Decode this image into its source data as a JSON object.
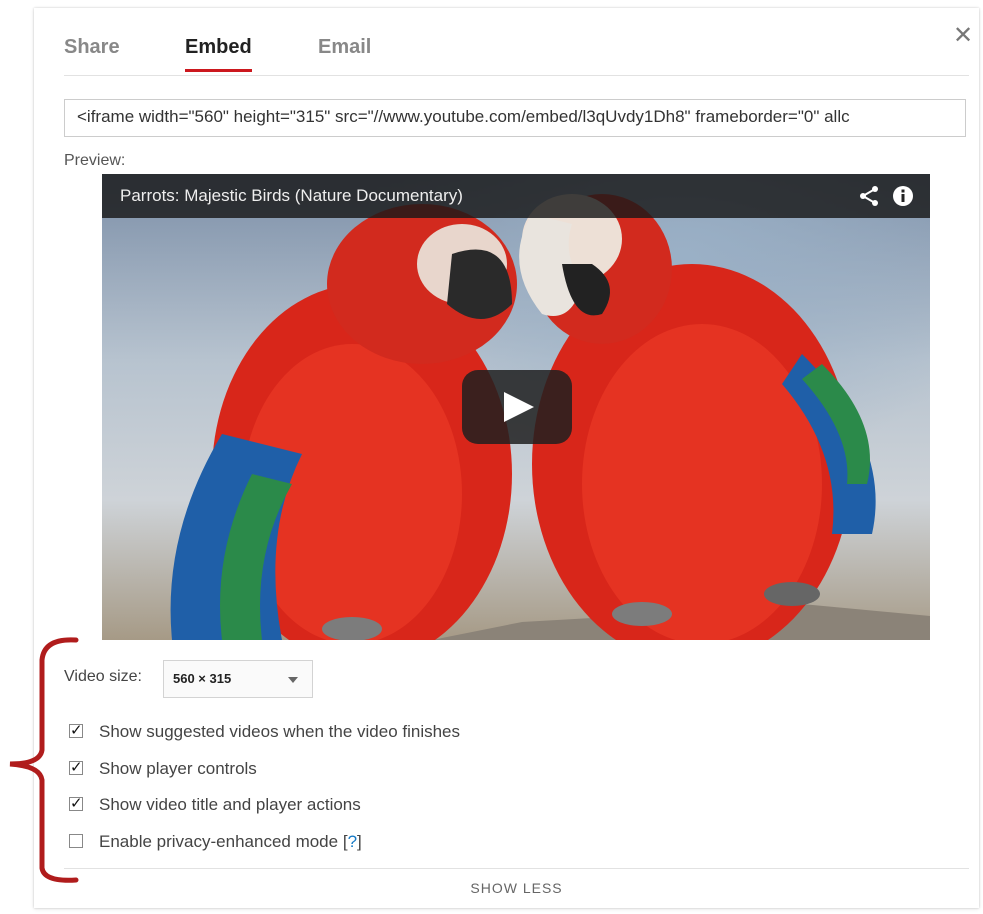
{
  "tabs": [
    {
      "label": "Share",
      "active": false
    },
    {
      "label": "Embed",
      "active": true
    },
    {
      "label": "Email",
      "active": false
    }
  ],
  "close_icon": "close-icon",
  "embed_code": "<iframe width=\"560\" height=\"315\" src=\"//www.youtube.com/embed/l3qUvdy1Dh8\" frameborder=\"0\" allc",
  "preview_label": "Preview:",
  "video": {
    "title": "Parrots: Majestic Birds (Nature Documentary)",
    "icons": [
      "share-icon",
      "info-icon",
      "play-icon"
    ]
  },
  "options": {
    "size_label": "Video size:",
    "size_value": "560 × 315",
    "checkboxes": [
      {
        "label": "Show suggested videos when the video finishes",
        "checked": true
      },
      {
        "label": "Show player controls",
        "checked": true
      },
      {
        "label": "Show video title and player actions",
        "checked": true
      },
      {
        "label": "Enable privacy-enhanced mode",
        "checked": false,
        "help": "?"
      }
    ]
  },
  "footer": {
    "show_less": "SHOW LESS"
  },
  "colors": {
    "accent": "#cc181e",
    "link": "#167ac6",
    "annotation": "#b01c1c"
  }
}
